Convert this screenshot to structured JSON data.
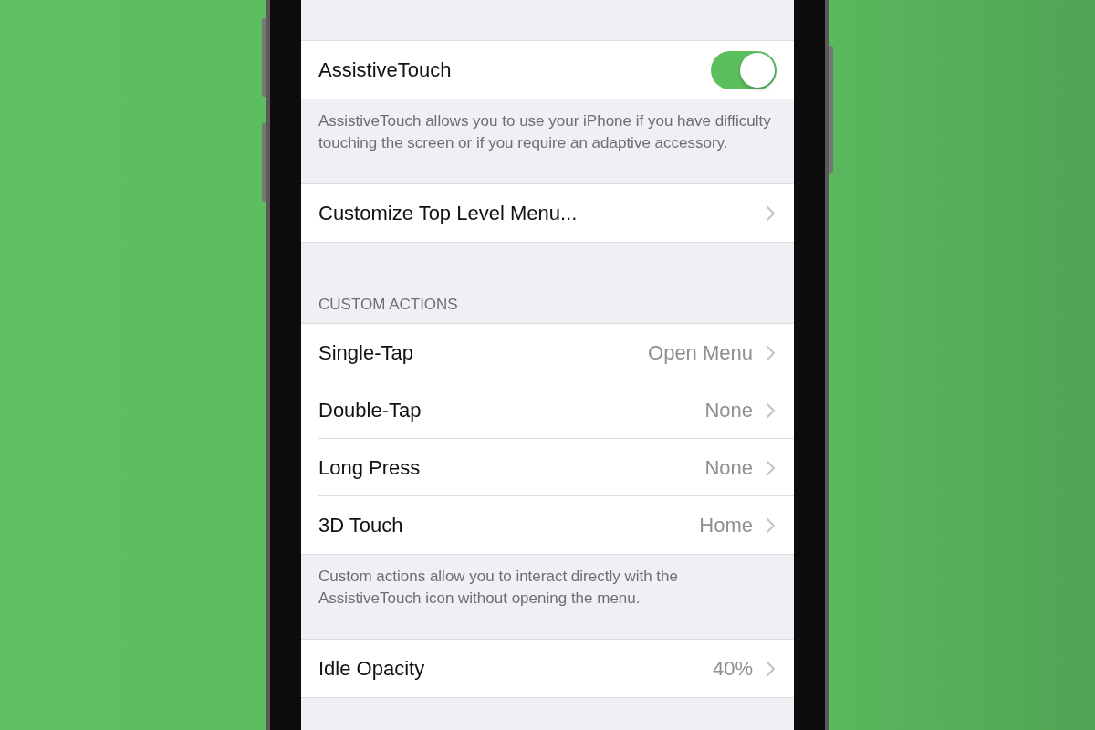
{
  "sections": [
    {
      "rows": [
        {
          "kind": "toggle",
          "label": "AssistiveTouch",
          "on": true
        }
      ],
      "footer": "AssistiveTouch allows you to use your iPhone if you have difficulty touching the screen or if you require an adaptive accessory."
    },
    {
      "rows": [
        {
          "kind": "link",
          "label": "Customize Top Level Menu..."
        }
      ]
    },
    {
      "header": "CUSTOM ACTIONS",
      "rows": [
        {
          "kind": "link",
          "label": "Single-Tap",
          "value": "Open Menu"
        },
        {
          "kind": "link",
          "label": "Double-Tap",
          "value": "None"
        },
        {
          "kind": "link",
          "label": "Long Press",
          "value": "None"
        },
        {
          "kind": "link",
          "label": "3D Touch",
          "value": "Home"
        }
      ],
      "footer": "Custom actions allow you to interact directly with the AssistiveTouch icon without opening the menu."
    },
    {
      "rows": [
        {
          "kind": "link",
          "label": "Idle Opacity",
          "value": "40%"
        }
      ]
    }
  ]
}
